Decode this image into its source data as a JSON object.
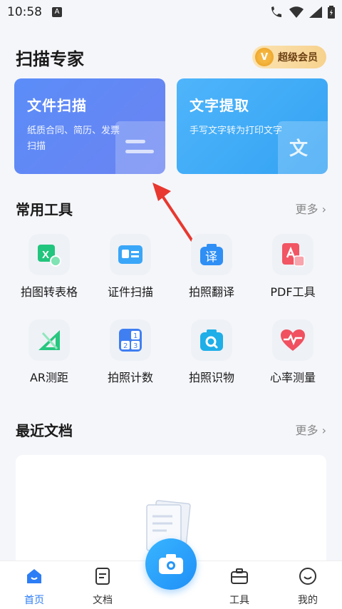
{
  "status_bar": {
    "time": "10:58",
    "notif_badge": "A"
  },
  "header": {
    "title": "扫描专家",
    "vip_label": "超级会员",
    "vip_letter": "V"
  },
  "cards": [
    {
      "title": "文件扫描",
      "subtitle": "纸质合同、简历、发票扫描"
    },
    {
      "title": "文字提取",
      "subtitle": "手写文字转为打印文字",
      "glyph": "文"
    }
  ],
  "tools_section": {
    "title": "常用工具",
    "more": "更多 ›"
  },
  "tools": [
    {
      "label": "拍图转表格",
      "icon": "excel-scan-icon"
    },
    {
      "label": "证件扫描",
      "icon": "id-card-icon"
    },
    {
      "label": "拍照翻译",
      "icon": "translate-icon",
      "glyph": "译"
    },
    {
      "label": "PDF工具",
      "icon": "pdf-icon"
    },
    {
      "label": "AR测距",
      "icon": "ar-ruler-icon"
    },
    {
      "label": "拍照计数",
      "icon": "count-icon"
    },
    {
      "label": "拍照识物",
      "icon": "object-recognize-icon"
    },
    {
      "label": "心率测量",
      "icon": "heart-rate-icon"
    }
  ],
  "docs_section": {
    "title": "最近文档",
    "more": "更多 ›"
  },
  "tabbar": [
    {
      "label": "首页",
      "icon": "home-icon",
      "active": true
    },
    {
      "label": "文档",
      "icon": "document-icon",
      "active": false
    },
    {
      "label": "工具",
      "icon": "toolbox-icon",
      "active": false
    },
    {
      "label": "我的",
      "icon": "profile-icon",
      "active": false
    }
  ],
  "colors": {
    "accent": "#2d7df6",
    "card_scan": "#5b8df8",
    "card_text": "#33a2f3",
    "arrow": "#e8382f"
  }
}
